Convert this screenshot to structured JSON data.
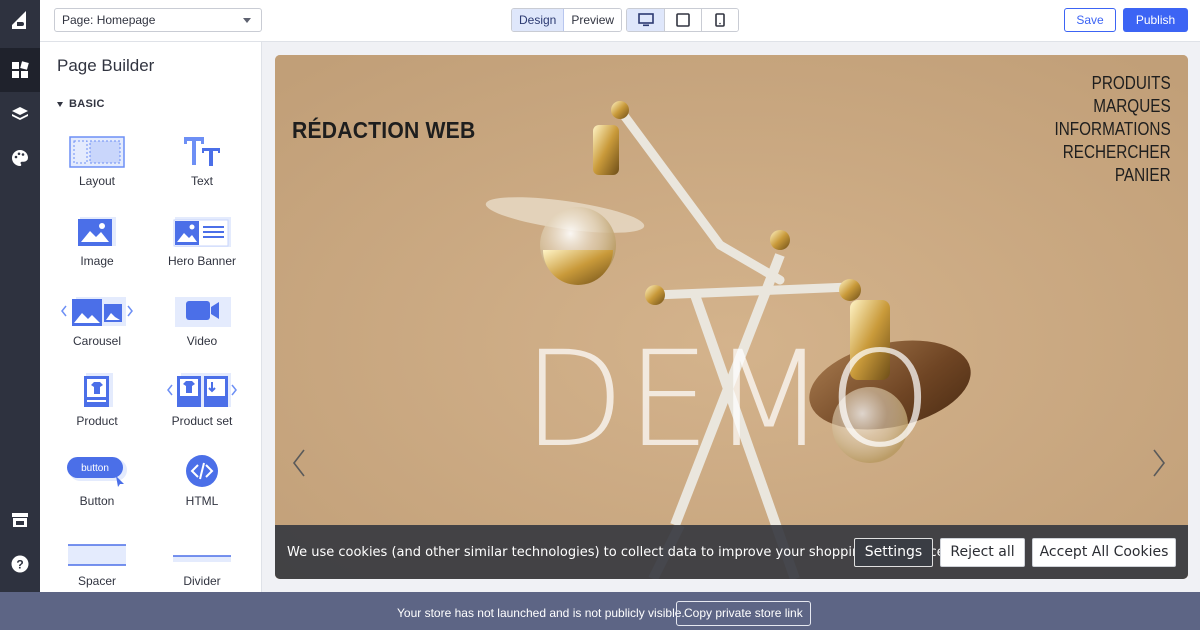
{
  "topbar": {
    "page_select_value": "Page: Homepage",
    "mode_tabs": [
      "Design",
      "Preview"
    ],
    "active_mode": "Design",
    "devices": [
      "desktop-icon",
      "tablet-icon",
      "mobile-icon"
    ],
    "active_device": "desktop",
    "save_label": "Save",
    "publish_label": "Publish",
    "accent_color": "#3c64f4"
  },
  "rail": {
    "items": [
      "widgets-icon",
      "layers-icon",
      "palette-icon",
      "storefront-icon",
      "help-icon"
    ]
  },
  "panel": {
    "title": "Page Builder",
    "section": "BASIC",
    "widgets": [
      {
        "label": "Layout",
        "icon": "layout-icon"
      },
      {
        "label": "Text",
        "icon": "text-icon"
      },
      {
        "label": "Image",
        "icon": "image-icon"
      },
      {
        "label": "Hero Banner",
        "icon": "hero-banner-icon"
      },
      {
        "label": "Carousel",
        "icon": "carousel-icon"
      },
      {
        "label": "Video",
        "icon": "video-icon"
      },
      {
        "label": "Product",
        "icon": "product-icon"
      },
      {
        "label": "Product set",
        "icon": "product-set-icon"
      },
      {
        "label": "Button",
        "icon": "button-icon",
        "icon_text": "button"
      },
      {
        "label": "HTML",
        "icon": "html-icon"
      },
      {
        "label": "Spacer",
        "icon": "spacer-icon"
      },
      {
        "label": "Divider",
        "icon": "divider-icon"
      }
    ]
  },
  "canvas": {
    "brand": "RÉDACTION WEB",
    "nav": [
      "PRODUITS",
      "MARQUES",
      "INFORMATIONS",
      "RECHERCHER",
      "PANIER"
    ],
    "watermark": "DEMO",
    "cookie": {
      "text": "We use cookies (and other similar technologies) to collect data to improve your shopping experience.",
      "settings_label": "Settings",
      "reject_label": "Reject all",
      "accept_label": "Accept All Cookies"
    }
  },
  "statusbar": {
    "text": "Your store has not launched and is not publicly visible.",
    "copy_link_label": "Copy private store link"
  }
}
